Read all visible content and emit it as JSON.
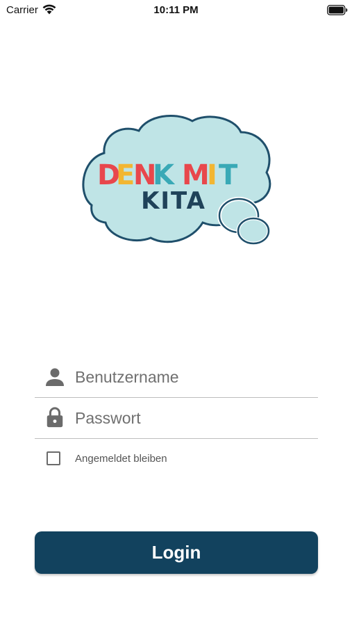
{
  "status_bar": {
    "carrier": "Carrier",
    "time": "10:11 PM",
    "icons": [
      "wifi-icon",
      "battery-icon"
    ]
  },
  "logo": {
    "line1": [
      "D",
      "E",
      "N",
      "K",
      " ",
      "M",
      "I",
      "T"
    ],
    "line2": "KITA",
    "colors": {
      "cloud": "#bfe4e6",
      "outline": "#1f4f6b",
      "d": "#e8474c",
      "e": "#f2b632",
      "n": "#e8474c",
      "k": "#39a9b6",
      "m": "#e8474c",
      "i": "#f2b632",
      "t": "#39a9b6",
      "kita": "#1f4259"
    }
  },
  "form": {
    "username": {
      "icon": "person-icon",
      "placeholder": "Benutzername",
      "value": ""
    },
    "password": {
      "icon": "lock-icon",
      "placeholder": "Passwort",
      "value": ""
    },
    "remember": {
      "label": "Angemeldet bleiben",
      "checked": false
    },
    "login_label": "Login"
  },
  "colors": {
    "primary": "#12425e",
    "divider": "#bdbdbd",
    "icon": "#6b6b6b"
  }
}
